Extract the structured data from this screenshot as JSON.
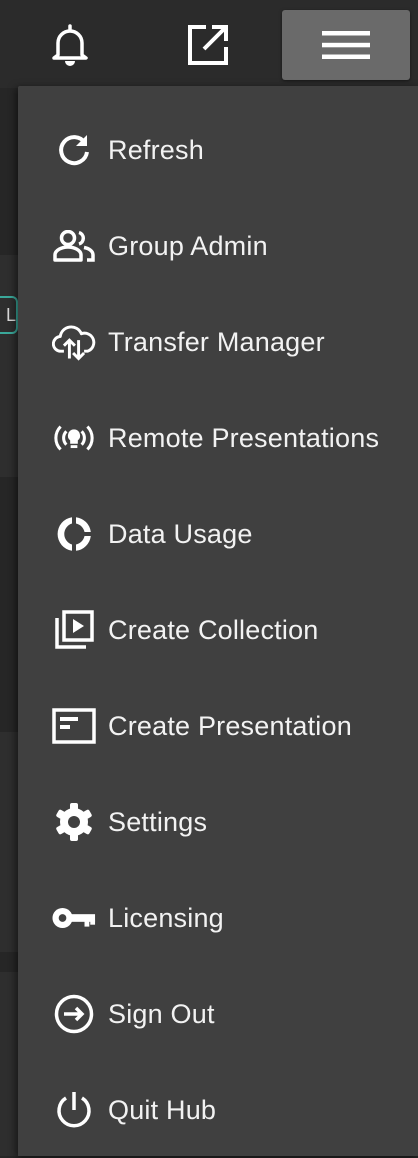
{
  "topbar": {
    "icons": [
      "bell-icon",
      "open-external-icon",
      "hamburger-menu-icon"
    ]
  },
  "background": {
    "tag_text": "L"
  },
  "menu": {
    "items": [
      {
        "label": "Refresh",
        "icon": "refresh-icon"
      },
      {
        "label": "Group Admin",
        "icon": "group-icon"
      },
      {
        "label": "Transfer Manager",
        "icon": "cloud-transfer-icon"
      },
      {
        "label": "Remote Presentations",
        "icon": "broadcast-icon"
      },
      {
        "label": "Data Usage",
        "icon": "donut-chart-icon"
      },
      {
        "label": "Create Collection",
        "icon": "collection-play-icon"
      },
      {
        "label": "Create Presentation",
        "icon": "presentation-icon"
      },
      {
        "label": "Settings",
        "icon": "gear-icon"
      },
      {
        "label": "Licensing",
        "icon": "key-icon"
      },
      {
        "label": "Sign Out",
        "icon": "sign-out-icon"
      },
      {
        "label": "Quit Hub",
        "icon": "power-icon"
      }
    ]
  },
  "colors": {
    "page_background": "#262626",
    "menu_background": "#404040",
    "menu_button_active": "#6a6a6a",
    "text": "#f2f2f2",
    "tag_border": "#3aa89a"
  }
}
